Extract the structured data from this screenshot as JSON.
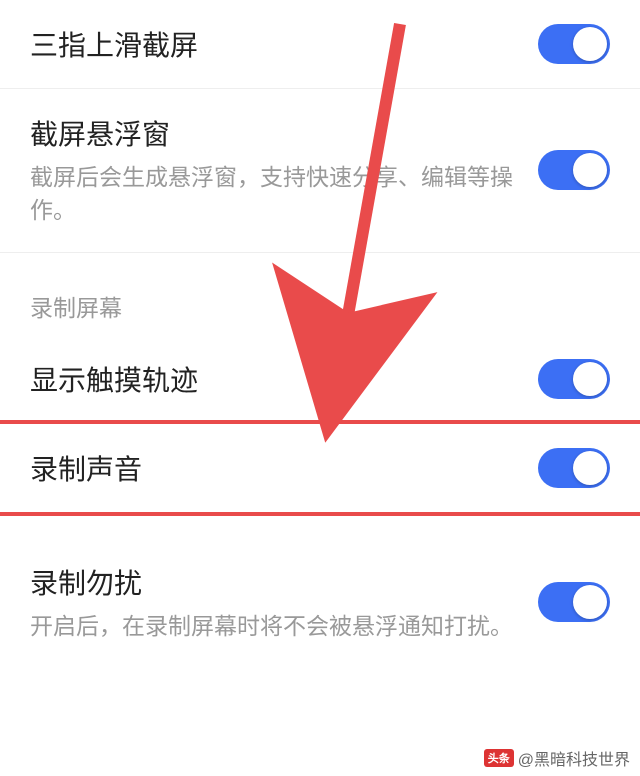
{
  "rows": {
    "three_finger": {
      "title": "三指上滑截屏",
      "toggle_on": true
    },
    "floating_window": {
      "title": "截屏悬浮窗",
      "desc": "截屏后会生成悬浮窗，支持快速分享、编辑等操作。",
      "toggle_on": true
    },
    "section_label": "录制屏幕",
    "show_touch": {
      "title": "显示触摸轨迹",
      "toggle_on": true
    },
    "record_audio": {
      "title": "录制声音",
      "toggle_on": true
    },
    "dnd_record": {
      "title": "录制勿扰",
      "desc": "开启后，在录制屏幕时将不会被悬浮通知打扰。",
      "toggle_on": true
    }
  },
  "watermark": {
    "badge": "头条",
    "text": "@黑暗科技世界"
  },
  "annotation": {
    "arrow_color": "#e94b4b",
    "highlight_target": "record_audio"
  }
}
